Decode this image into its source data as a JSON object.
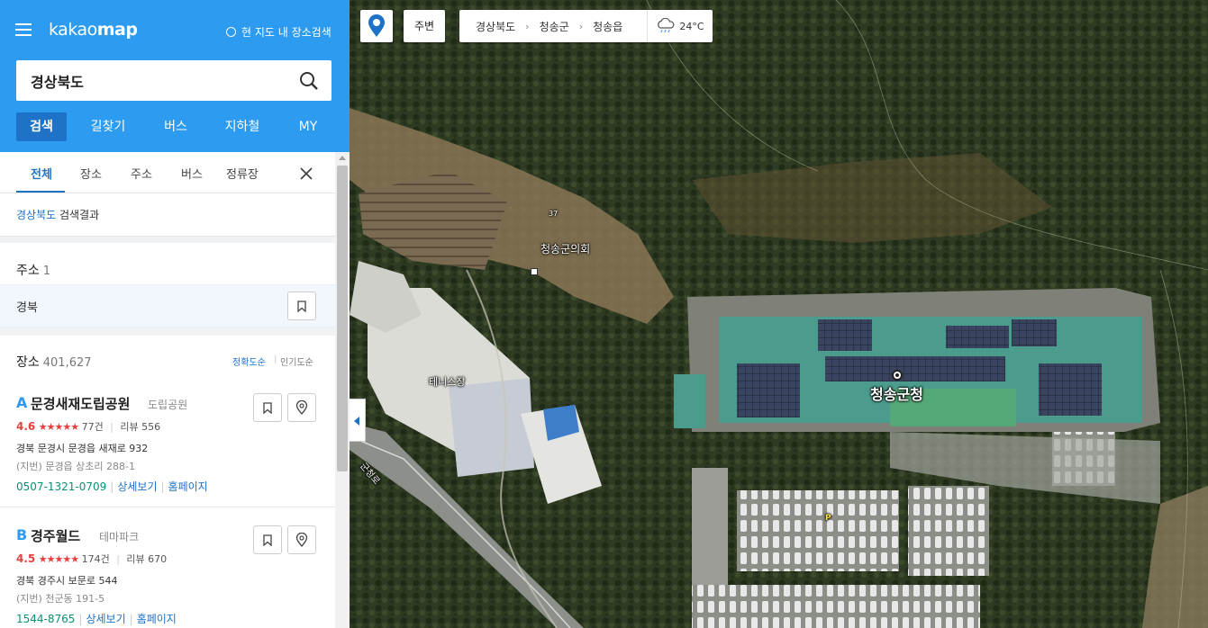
{
  "app": {
    "logo_regular": "kakao",
    "logo_bold": "map",
    "search_in_map_label": "현 지도 내 장소검색"
  },
  "search": {
    "query": "경상북도"
  },
  "main_tabs": [
    "검색",
    "길찾기",
    "버스",
    "지하철",
    "MY"
  ],
  "sub_tabs": [
    "전체",
    "장소",
    "주소",
    "버스",
    "정류장"
  ],
  "result_header": {
    "keyword": "경상북도",
    "suffix": "검색결과"
  },
  "address_section": {
    "title": "주소",
    "count": "1",
    "item": "경북"
  },
  "place_section": {
    "title": "장소",
    "count": "401,627",
    "sort_accuracy": "정확도순",
    "sort_popularity": "인기도순"
  },
  "places": [
    {
      "letter": "A",
      "name": "문경새재도립공원",
      "category": "도립공원",
      "score": "4.6",
      "stars": "★★★★★",
      "rating_count": "77건",
      "review": "리뷰 556",
      "address": "경북 문경시 문경읍 새재로 932",
      "jibun": "(지번) 문경읍 상초리 288-1",
      "phone": "0507-1321-0709",
      "detail_link": "상세보기",
      "homepage_link": "홈페이지"
    },
    {
      "letter": "B",
      "name": "경주월드",
      "category": "테마파크",
      "score": "4.5",
      "stars": "★★★★★",
      "rating_count": "174건",
      "review": "리뷰 670",
      "address": "경북 경주시 보문로 544",
      "jibun": "(지번) 천군동 191-5",
      "phone": "1544-8765",
      "detail_link": "상세보기",
      "homepage_link": "홈페이지"
    }
  ],
  "map": {
    "near_label": "주변",
    "breadcrumb": [
      "경상북도",
      "청송군",
      "청송읍"
    ],
    "temperature": "24°C",
    "labels": {
      "council": "청송군의회",
      "office": "청송군청",
      "tennis": "테니스장",
      "road_number": "37",
      "road_name": "군청로",
      "parking": "P"
    }
  },
  "colors": {
    "brand_blue": "#2c9bf0",
    "active_tab": "#1e72c8",
    "rating_red": "#e1423f",
    "phone_green": "#089171"
  }
}
